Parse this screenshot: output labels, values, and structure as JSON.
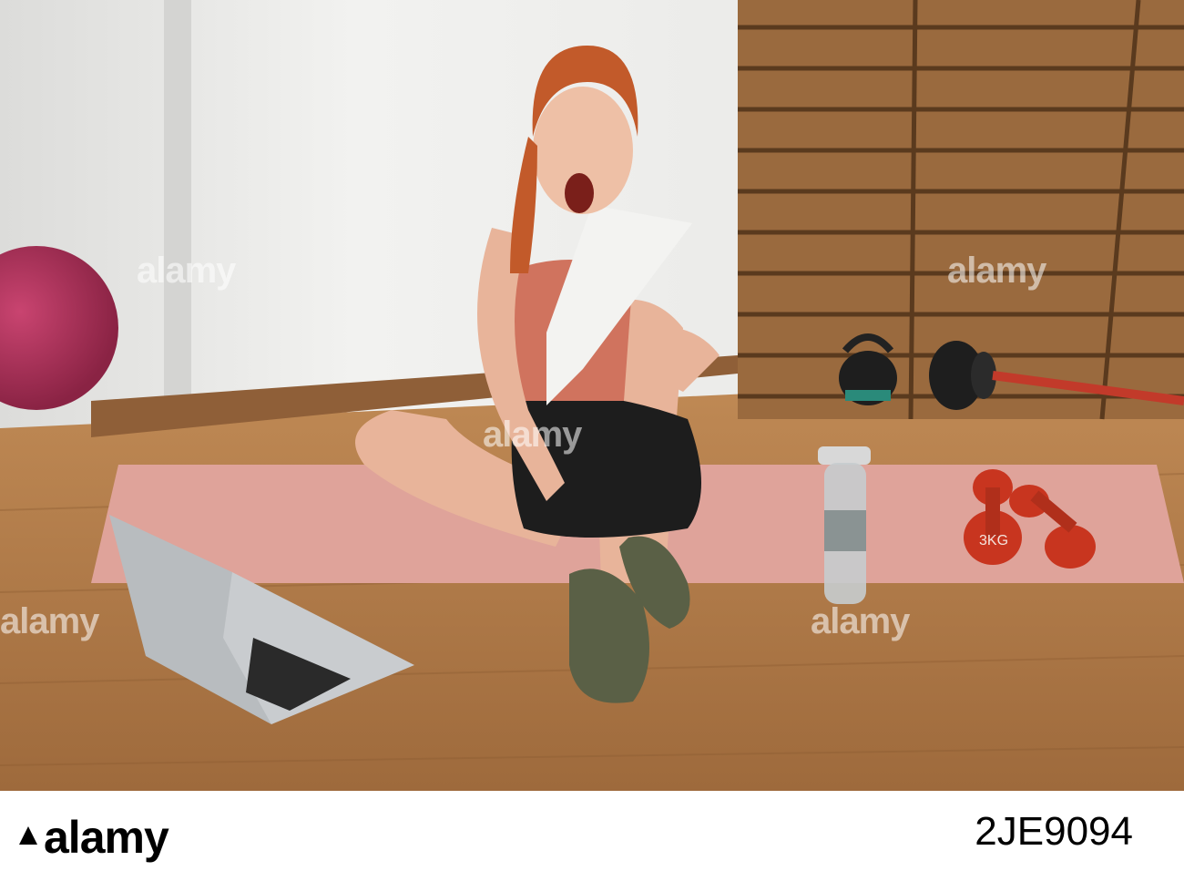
{
  "watermark": {
    "text": "alamy"
  },
  "footer": {
    "logo_text": "alamy",
    "image_id": "2JE9094"
  },
  "scene": {
    "dumbbell_label": "3KG",
    "colors": {
      "wall": "#ececea",
      "floor": "#b07a48",
      "mat": "#dfa39a",
      "ball": "#b2305a",
      "dumbbell": "#c8351f",
      "crates": "#9a6a3e",
      "top": "#d0735e",
      "shoes": "#5a6046"
    }
  }
}
